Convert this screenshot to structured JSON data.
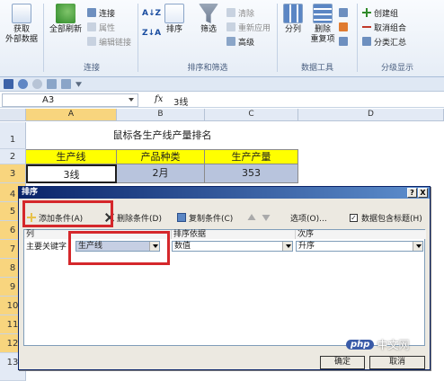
{
  "ribbon": {
    "get_external": "获取\n外部数据",
    "refresh_all": "全部刷新",
    "connections": "连接",
    "properties": "属性",
    "edit_links": "编辑链接",
    "group_connect": "连接",
    "sort_az": "A↓Z",
    "sort_za": "Z↓A",
    "sort": "排序",
    "filter": "筛选",
    "clear": "清除",
    "reapply": "重新应用",
    "advanced": "高级",
    "group_sort_filter": "排序和筛选",
    "split": "分列",
    "remove_dup": "删除\n重复项",
    "group_data_tools": "数据工具",
    "create_group": "创建组",
    "ungroup": "取消组合",
    "subtotal": "分类汇总",
    "group_outline": "分级显示"
  },
  "formula": {
    "name_box": "A3",
    "fx": "fx",
    "value": "3线"
  },
  "columns": [
    "A",
    "B",
    "C",
    "D"
  ],
  "rows": [
    "1",
    "2",
    "3",
    "4",
    "5",
    "6",
    "7",
    "8",
    "9",
    "10",
    "11",
    "12",
    "13"
  ],
  "sheet": {
    "title": "鼠标各生产线产量排名",
    "headers": [
      "生产线",
      "产品种类",
      "生产产量"
    ],
    "row3": [
      "3线",
      "2月",
      "353"
    ]
  },
  "dialog": {
    "title": "排序",
    "help": "?",
    "close": "X",
    "add_condition": "添加条件(A)",
    "delete_condition": "删除条件(D)",
    "copy_condition": "复制条件(C)",
    "options": "选项(O)...",
    "has_headers_check": "✓",
    "has_headers": "数据包含标题(H)",
    "col_header": "列",
    "sort_on_header": "排序依据",
    "order_header": "次序",
    "main_key_label": "主要关键字",
    "main_key_value": "生产线",
    "sort_on_value": "数值",
    "order_value": "升序",
    "ok": "确定",
    "cancel": "取消"
  },
  "watermark": {
    "brand": "php",
    "text": "中文网"
  },
  "colors": {
    "accent": "#0a246a",
    "highlight": "#d5272b",
    "header_fill": "#ffff00"
  }
}
